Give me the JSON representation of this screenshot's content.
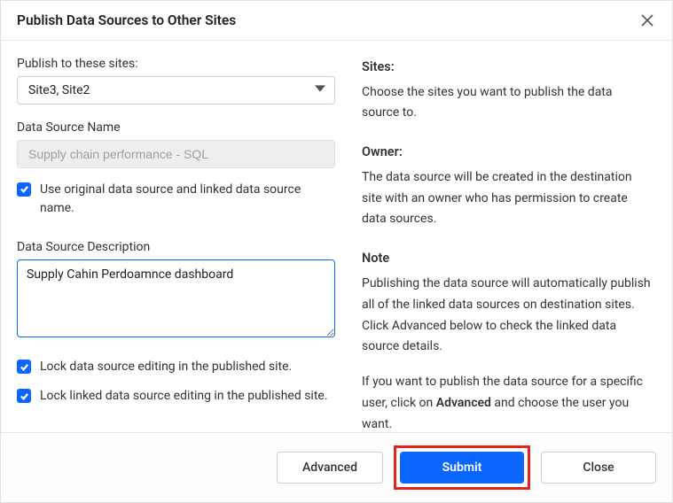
{
  "dialog": {
    "title": "Publish Data Sources to Other Sites"
  },
  "form": {
    "sites_label": "Publish to these sites:",
    "sites_value": "Site3, Site2",
    "ds_name_label": "Data Source Name",
    "ds_name_value": "Supply chain performance - SQL",
    "use_original_label": "Use original data source and linked data source name.",
    "desc_label": "Data Source Description",
    "desc_value": "Supply Cahin Perdoamnce dashboard",
    "lock_ds_label": "Lock data source editing in the published site.",
    "lock_linked_label": "Lock linked data source editing in the published site."
  },
  "info": {
    "sites_heading": "Sites:",
    "sites_text": "Choose the sites you want to publish the data source to.",
    "owner_heading": "Owner:",
    "owner_text": "The data source will be created in the destination site with an owner who has permission to create data sources.",
    "note_heading": "Note",
    "note_text1": "Publishing the data source will automatically publish all of the linked data sources on destination sites. Click Advanced below to check the linked data source details.",
    "note_text2a": "If you want to publish the data source for a specific user, click on ",
    "note_bold": "Advanced",
    "note_text2b": " and choose the user you want."
  },
  "footer": {
    "advanced": "Advanced",
    "submit": "Submit",
    "close": "Close"
  }
}
